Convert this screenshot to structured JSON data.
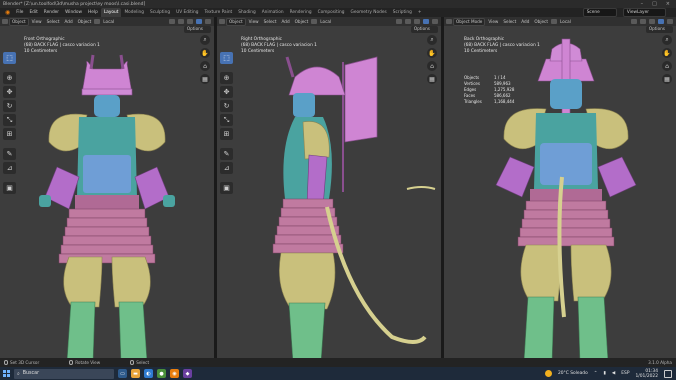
{
  "window": {
    "title": "Blender* [Z:\\un.toolfod\\3d\\musha project\\ey moos\\l.casi.blend]",
    "controls": [
      "–",
      "□",
      "×"
    ]
  },
  "menubar": {
    "items": [
      "File",
      "Edit",
      "Render",
      "Window",
      "Help"
    ],
    "tabs": [
      "Layout",
      "Modeling",
      "Sculpting",
      "UV Editing",
      "Texture Paint",
      "Shading",
      "Animation",
      "Rendering",
      "Compositing",
      "Geometry Nodes",
      "Scripting",
      "+"
    ],
    "active_tab": "Layout",
    "scene_label": "Scene",
    "view_layer_label": "ViewLayer"
  },
  "viewports": [
    {
      "mode": "Object",
      "menus": [
        "View",
        "Select",
        "Add",
        "Object"
      ],
      "transform": "Local",
      "options": "Options",
      "view_name": "Front Orthographic",
      "collection": "(68) BACK FLAG | casco variacion 1",
      "scale": "10 Centimeters"
    },
    {
      "mode": "Object",
      "menus": [
        "View",
        "Select",
        "Add",
        "Object"
      ],
      "transform": "Local",
      "options": "Options",
      "view_name": "Right Orthographic",
      "collection": "(68) BACK FLAG | casco variacion 1",
      "scale": "10 Centimeters"
    },
    {
      "mode": "Object Mode",
      "menus": [
        "View",
        "Select",
        "Add",
        "Object"
      ],
      "transform": "Local",
      "options": "Options",
      "view_name": "Back Orthographic",
      "collection": "(68) BACK FLAG | casco variacion 1",
      "scale": "10 Centimeters",
      "stats": [
        {
          "label": "Objects",
          "value": "1 / 14"
        },
        {
          "label": "Vertices",
          "value": "589,963"
        },
        {
          "label": "Edges",
          "value": "1,275,928"
        },
        {
          "label": "Faces",
          "value": "586,662"
        },
        {
          "label": "Triangles",
          "value": "1,168,444"
        }
      ]
    }
  ],
  "statusbar": {
    "items": [
      "Set 3D Cursor",
      "Rotate View",
      "Select"
    ],
    "version": "3.1.0 Alpha"
  },
  "taskbar": {
    "search_placeholder": "Buscar",
    "weather": "20°C  Soleado",
    "language": "ESP",
    "time": "01:34",
    "date": "1/01/2022"
  },
  "colors": {
    "helmet": "#cf85d3",
    "armor_teal": "#4aa3a0",
    "armor_blue": "#6f9ed6",
    "gold": "#c9c07c",
    "lilac": "#b36dc9",
    "legs": "#6fbf8a",
    "accent": "#4772b3"
  }
}
